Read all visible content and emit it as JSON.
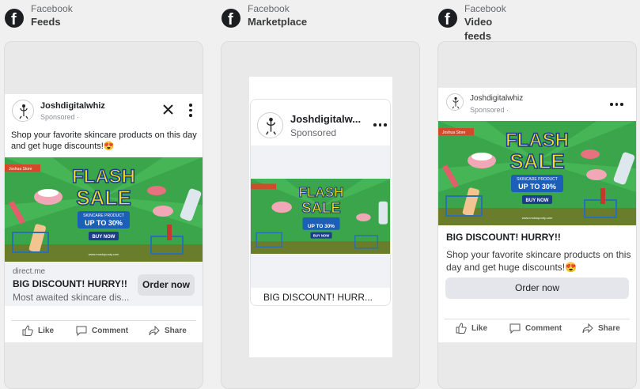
{
  "columns": [
    {
      "platform": "Facebook",
      "placement": "Feeds"
    },
    {
      "platform": "Facebook",
      "placement": "Marketplace"
    },
    {
      "platform": "Facebook",
      "placement": "Video feeds"
    }
  ],
  "post": {
    "username": "Joshdigitalwhiz",
    "username_truncated": "Joshdigitalw...",
    "sponsored": "Sponsored",
    "sponsored_dot": "Sponsored · ",
    "primary_text": "Shop your favorite skincare products on this day and get huge discounts!😍",
    "domain": "direct.me",
    "headline": "BIG DISCOUNT! HURRY!!",
    "headline_truncated": "BIG DISCOUNT! HURR...",
    "description": "Most awaited skincare dis...",
    "cta": "Order now"
  },
  "ad_creative": {
    "store": "Joshua Store",
    "line1": "FLASH",
    "line2": "SALE",
    "badge_top": "SKINCARE PRODUCT",
    "badge_bottom": "UP TO 30%",
    "buy": "BUY NOW",
    "url": "www.mostupooty.com"
  },
  "actions": {
    "like": "Like",
    "comment": "Comment",
    "share": "Share"
  },
  "colors": {
    "green": "#3aa54a",
    "yellow": "#f9e01f",
    "blue": "#1c5fb8",
    "ground": "#6a7d2c"
  }
}
